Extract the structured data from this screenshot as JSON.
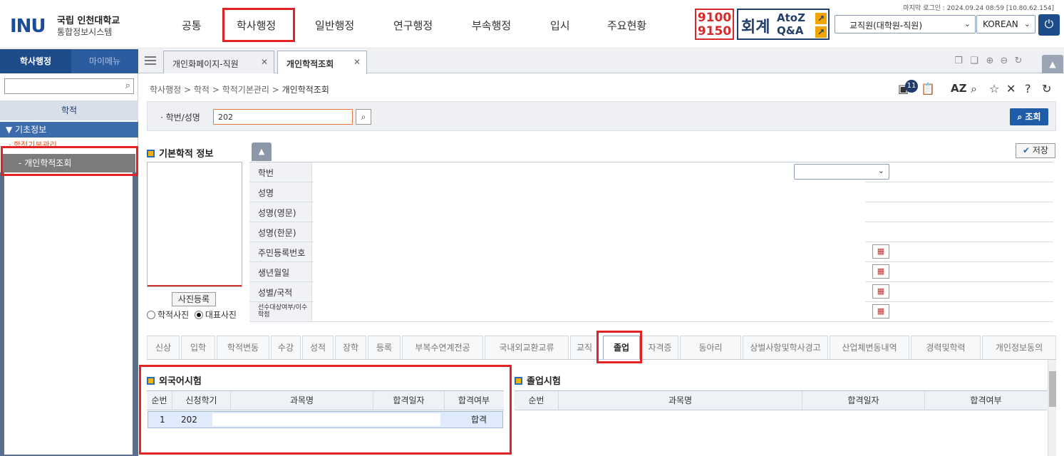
{
  "header": {
    "logo_mark": "INU",
    "logo_line1": "국립 인천대학교",
    "logo_line2": "통합정보시스템",
    "nav": [
      "공통",
      "학사행정",
      "일반행정",
      "연구행정",
      "부속행정",
      "입시",
      "주요현황"
    ],
    "last_login": "마지막 로그인 : 2024.09.24 08:59 [10.80.62.154]",
    "phone_box": [
      "9100",
      "9150"
    ],
    "accounting_label": "회계",
    "atoz_line1": "AtoZ",
    "atoz_line2": "Q&A",
    "role_select": "교직원(대학원-직원)",
    "language_select": "KOREAN",
    "colors": {
      "brand": "#1e4b8a",
      "highlight": "#e12323"
    }
  },
  "sidebar": {
    "tab_active": "학사행정",
    "tab_other": "마이메뉴",
    "search_placeholder": "",
    "section": "학적",
    "category": "▼ 기초정보",
    "group": "· 학적기본관리",
    "item_active": "- 개인학적조회"
  },
  "tabs": [
    {
      "label": "개인화페이지-직원",
      "active": false
    },
    {
      "label": "개인학적조회",
      "active": true
    }
  ],
  "breadcrumb": {
    "parts": [
      "학사행정",
      "학적",
      "학적기본관리"
    ],
    "current": "개인학적조회",
    "separator": ">",
    "notice_count": "11"
  },
  "search": {
    "label": "학번/성명",
    "value": "202",
    "query_button": "조회"
  },
  "basic_info": {
    "title": "기본학적 정보",
    "save_button": "저장",
    "photo_button": "사진등록",
    "radio_options": [
      {
        "label": "학적사진",
        "checked": false
      },
      {
        "label": "대표사진",
        "checked": true
      }
    ],
    "fields": [
      "학번",
      "성명",
      "성명(영문)",
      "성명(한문)",
      "주민등록번호",
      "생년월일",
      "성별/국적",
      "선수대상여부/이수학점"
    ]
  },
  "detail_tabs": [
    "신상",
    "입학",
    "학적변동",
    "수강",
    "성적",
    "장학",
    "등록",
    "부복수연계전공",
    "국내외교환교류",
    "교직",
    "졸업",
    "자격증",
    "동아리",
    "상벌사항및학사경고",
    "산업체변동내역",
    "경력및학력",
    "개인정보동의"
  ],
  "active_detail_tab": "졸업",
  "foreign_exam": {
    "title": "외국어시험",
    "columns": [
      "순번",
      "신청학기",
      "과목명",
      "합격일자",
      "합격여부"
    ],
    "rows": [
      {
        "seq": "1",
        "term": "202",
        "subject": "",
        "date": "",
        "result": "합격"
      }
    ]
  },
  "graduation_exam": {
    "title": "졸업시험",
    "columns": [
      "순번",
      "과목명",
      "합격일자",
      "합격여부"
    ]
  }
}
